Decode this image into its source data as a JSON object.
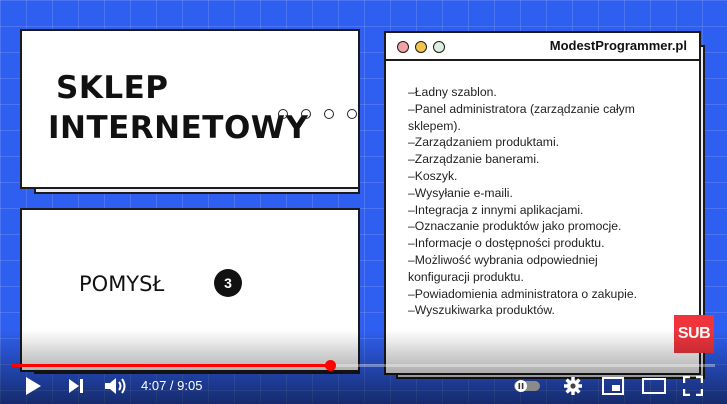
{
  "slide": {
    "title_line1": "SKLEP",
    "title_line2": "INTERNETOWY",
    "idea_label": "POMYSŁ",
    "idea_number": "3"
  },
  "browser_window": {
    "site": "ModestProgrammer.pl",
    "features": [
      "–Ładny szablon.",
      "–Panel administratora (zarządzanie całym",
      "sklepem).",
      "–Zarządzaniem produktami.",
      "–Zarządzanie banerami.",
      "–Koszyk.",
      "–Wysyłanie e-maili.",
      "–Integracja z innymi aplikacjami.",
      "–Oznaczanie produktów jako promocje.",
      "–Informacje o dostępności produktu.",
      "–Możliwość wybrania odpowiedniej",
      "konfiguracji produktu.",
      "–Powiadomienia administratora o zakupie.",
      "–Wyszukiwarka produktów."
    ]
  },
  "subscribe_badge": "SUB",
  "player": {
    "current_time": "4:07",
    "duration": "9:05",
    "time_display": "4:07 / 9:05",
    "progress_fraction": 0.453,
    "colors": {
      "progress": "#ff0000",
      "background": "#2f5ff0",
      "subscribe": "#f0343c"
    },
    "icons": [
      "play-icon",
      "next-icon",
      "volume-icon",
      "autoplay-toggle-icon",
      "settings-icon",
      "miniplayer-icon",
      "theater-icon",
      "fullscreen-icon"
    ]
  }
}
